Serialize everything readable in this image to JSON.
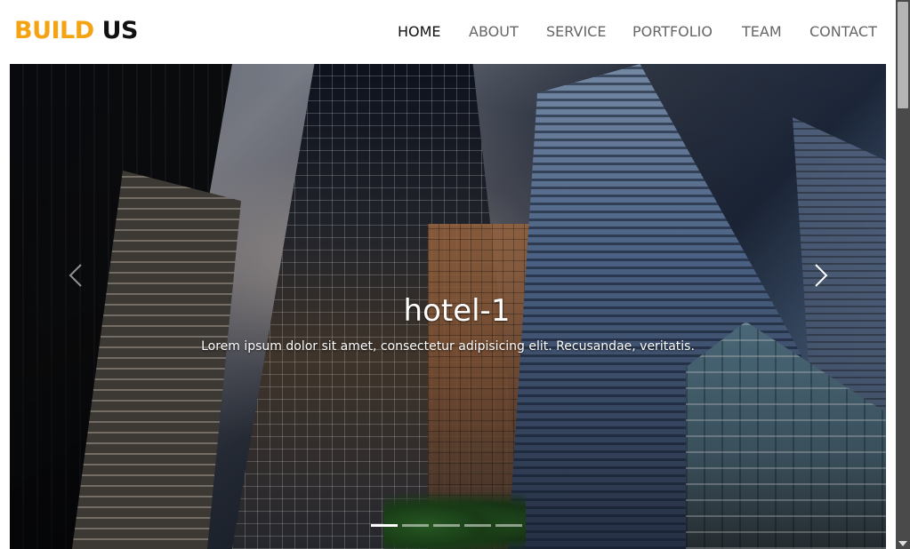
{
  "brand": {
    "part1": "BUILD",
    "part2": "US"
  },
  "nav": {
    "items": [
      {
        "label": "HOME",
        "active": true
      },
      {
        "label": "ABOUT",
        "active": false
      },
      {
        "label": "SERVICE",
        "active": false
      },
      {
        "label": "PORTFOLIO",
        "active": false
      },
      {
        "label": "TEAM",
        "active": false
      },
      {
        "label": "CONTACT",
        "active": false
      }
    ]
  },
  "carousel": {
    "caption_title": "hotel-1",
    "caption_text": "Lorem ipsum dolor sit amet, consectetur adipisicing elit. Recusandae, veritatis.",
    "slide_count": 5,
    "active_slide": 1
  },
  "colors": {
    "brand_accent": "#f5a213",
    "nav_active": "#111111",
    "nav_inactive": "#666666"
  },
  "icons": {
    "prev": "chevron-left-icon",
    "next": "chevron-right-icon"
  }
}
